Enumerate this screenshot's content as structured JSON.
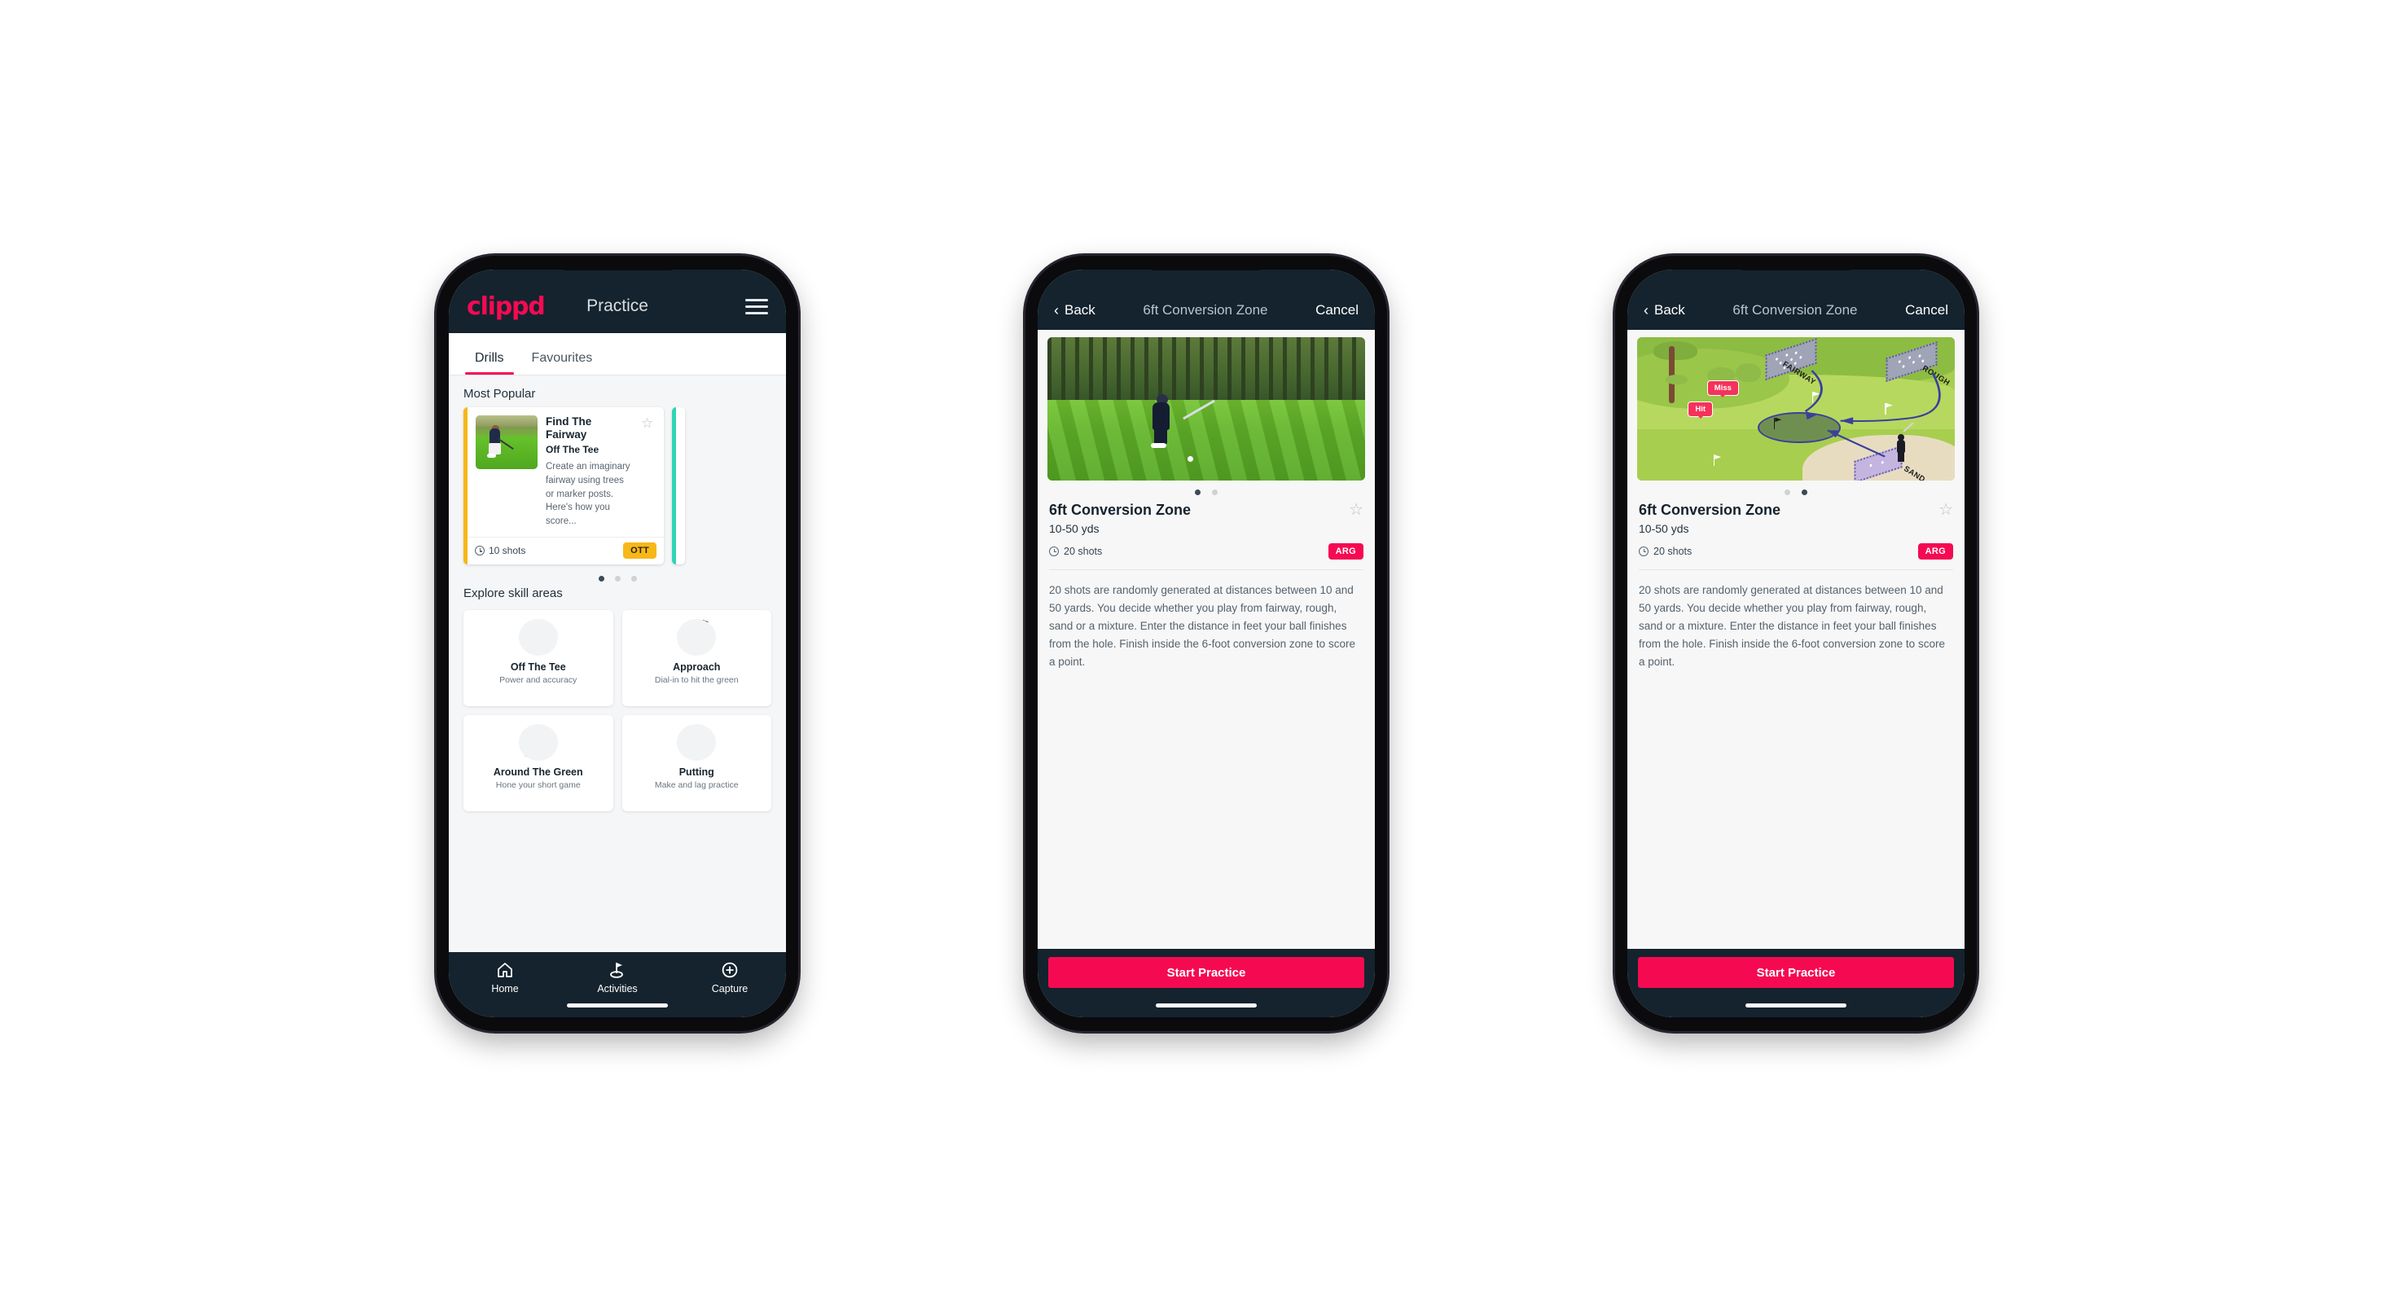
{
  "phone1": {
    "header": {
      "brand": "clippd",
      "title": "Practice",
      "menu_icon": "hamburger-icon"
    },
    "tabs": [
      {
        "label": "Drills",
        "active": true
      },
      {
        "label": "Favourites",
        "active": false
      }
    ],
    "sections": {
      "most_popular": "Most Popular",
      "explore": "Explore skill areas"
    },
    "drill_card": {
      "name": "Find The Fairway",
      "category": "Off The Tee",
      "description": "Create an imaginary fairway using trees or marker posts. Here's how you score...",
      "shots": "10 shots",
      "badge": "OTT",
      "badge_color": "#f6b819",
      "accent_color": "#f6b819",
      "star_icon": "star-outline-icon"
    },
    "carousel_dots": {
      "count": 3,
      "active_index": 0
    },
    "skill_areas": [
      {
        "name": "Off The Tee",
        "desc": "Power and accuracy",
        "icon": "tee-fan-icon",
        "dot_color": "#f6b819"
      },
      {
        "name": "Approach",
        "desc": "Dial-in to hit the green",
        "icon": "green-approach-icon",
        "dot_color": "#2fd6b5"
      },
      {
        "name": "Around The Green",
        "desc": "Hone your short game",
        "icon": "chip-icon",
        "dot_color": "#f50a52"
      },
      {
        "name": "Putting",
        "desc": "Make and lag practice",
        "icon": "putt-rings-icon",
        "dot_color": "#a02bd4"
      }
    ],
    "bottom_nav": [
      {
        "label": "Home",
        "icon": "home-icon",
        "active": false
      },
      {
        "label": "Activities",
        "icon": "golf-flag-icon",
        "active": true
      },
      {
        "label": "Capture",
        "icon": "plus-circle-icon",
        "active": false
      }
    ]
  },
  "phone2": {
    "nav": {
      "back": "Back",
      "title": "6ft Conversion Zone",
      "cancel": "Cancel",
      "back_icon": "chevron-left-icon"
    },
    "media": {
      "type": "photo",
      "alt": "golfer-chipping-photo"
    },
    "dots": {
      "count": 2,
      "active_index": 0
    },
    "detail": {
      "title": "6ft Conversion Zone",
      "distance": "10-50 yds",
      "shots": "20 shots",
      "badge": "ARG",
      "badge_color": "#f50a52",
      "star_icon": "star-outline-icon",
      "description": "20 shots are randomly generated at distances between 10 and 50 yards. You decide whether you play from fairway, rough, sand or a mixture. Enter the distance in feet your ball finishes from the hole. Finish inside the 6-foot conversion zone to score a point."
    },
    "cta": "Start Practice"
  },
  "phone3": {
    "nav": {
      "back": "Back",
      "title": "6ft Conversion Zone",
      "cancel": "Cancel",
      "back_icon": "chevron-left-icon"
    },
    "media": {
      "type": "illustration",
      "labels": [
        "FAIRWAY",
        "ROUGH",
        "SAND"
      ],
      "tooltips": [
        "Miss",
        "Hit"
      ],
      "tooltip_color": "#f5325b"
    },
    "dots": {
      "count": 2,
      "active_index": 1
    },
    "detail": {
      "title": "6ft Conversion Zone",
      "distance": "10-50 yds",
      "shots": "20 shots",
      "badge": "ARG",
      "badge_color": "#f50a52",
      "star_icon": "star-outline-icon",
      "description": "20 shots are randomly generated at distances between 10 and 50 yards. You decide whether you play from fairway, rough, sand or a mixture. Enter the distance in feet your ball finishes from the hole. Finish inside the 6-foot conversion zone to score a point."
    },
    "cta": "Start Practice"
  },
  "theme": {
    "brand_pink": "#f50a52",
    "header_navy": "#14232e",
    "badge_amber": "#f6b819",
    "teal": "#2fd6b5",
    "page_bg": "#f5f6f7"
  }
}
